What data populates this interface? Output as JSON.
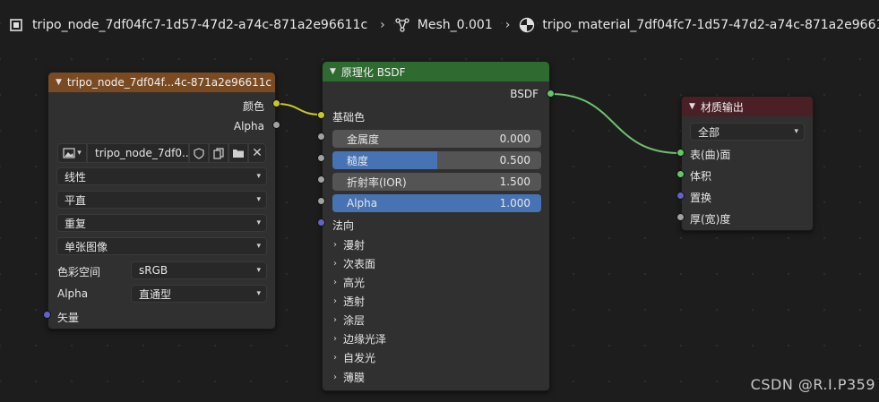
{
  "breadcrumb": {
    "object_name": "tripo_node_7df04fc7-1d57-47d2-a74c-871a2e96611c",
    "mesh_name": "Mesh_0.001",
    "material_name": "tripo_material_7df04fc7-1d57-47d2-a74c-871a2e96611c"
  },
  "image_node": {
    "title": "tripo_node_7df04f...4c-871a2e96611c",
    "header_color": "#7a4a22",
    "output_color": "颜色",
    "output_alpha": "Alpha",
    "image_name": "tripo_node_7df0...",
    "interpolation": "线性",
    "projection": "平直",
    "extension": "重复",
    "source": "单张图像",
    "color_space_label": "色彩空间",
    "color_space_value": "sRGB",
    "alpha_label": "Alpha",
    "alpha_value": "直通型",
    "vector_input": "矢量"
  },
  "bsdf_node": {
    "title": "原理化 BSDF",
    "header_color": "#2f6a30",
    "output_bsdf": "BSDF",
    "base_color": "基础色",
    "metallic_label": "金属度",
    "metallic_value": "0.000",
    "roughness_label": "糙度",
    "roughness_value": "0.500",
    "roughness_fraction": 0.5,
    "ior_label": "折射率(IOR)",
    "ior_value": "1.500",
    "alpha_label": "Alpha",
    "alpha_value": "1.000",
    "alpha_fraction": 1.0,
    "normal": "法向",
    "panels": [
      "漫射",
      "次表面",
      "高光",
      "透射",
      "涂层",
      "边缘光泽",
      "自发光",
      "薄膜"
    ]
  },
  "output_node": {
    "title": "材质输出",
    "header_color": "#4a1f25",
    "target": "全部",
    "surface": "表(曲)面",
    "volume": "体积",
    "displacement": "置换",
    "thickness": "厚(宽)度"
  },
  "colors": {
    "socket_color": "#c7c729",
    "socket_shader": "#63c763",
    "socket_float": "#a1a1a1",
    "socket_vector": "#6363c7",
    "slider_fill": "#4772b3",
    "link_color_yellow": "#c7c729",
    "link_shader_green": "#6fc16f"
  },
  "watermark": "CSDN @R.I.P359"
}
